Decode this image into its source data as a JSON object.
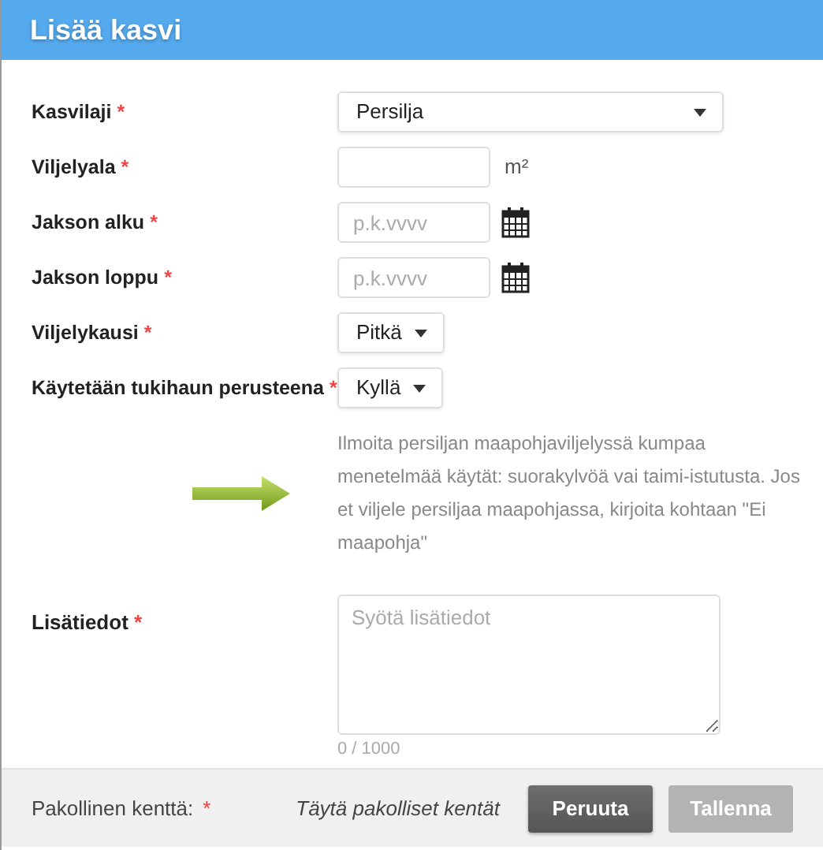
{
  "window": {
    "title": "Lisää kasvi"
  },
  "fields": [
    {
      "label": "Kasvilaji",
      "marker": "*",
      "kind": "wide_select",
      "value": "Persilja"
    },
    {
      "label": "Viljelyala",
      "marker": "*",
      "kind": "input",
      "unit": "m²"
    },
    {
      "label": "Jakson alku",
      "marker": "*",
      "kind": "date",
      "placeholder": "p.k.vvvv"
    },
    {
      "label": "Jakson loppu",
      "marker": "*",
      "kind": "date",
      "placeholder": "p.k.vvvv"
    },
    {
      "label": "Viljelykausi",
      "marker": "*",
      "kind": "select",
      "value": "Pitkä"
    },
    {
      "label": "Käytetään tukihaun perusteena",
      "marker": "*",
      "kind": "select",
      "value": "Kyllä"
    }
  ],
  "hint": "Ilmoita persiljan maapohjaviljelyssä kumpaa menetelmää käytät: suorakylvöä vai taimi-istutusta. Jos et viljele persiljaa maapohjassa, kirjoita kohtaan \"Ei maapohja\"",
  "notes": {
    "label": "Lisätiedot",
    "marker": "*",
    "placeholder": "Syötä lisätiedot",
    "counter": "0 / 1000"
  },
  "footer": {
    "legend": "Pakollinen kenttä:",
    "marker": "*",
    "status": "Täytä pakolliset kentät",
    "buttons": [
      {
        "label": "Peruuta",
        "disabled": false
      },
      {
        "label": "Tallenna",
        "disabled": true
      }
    ]
  }
}
